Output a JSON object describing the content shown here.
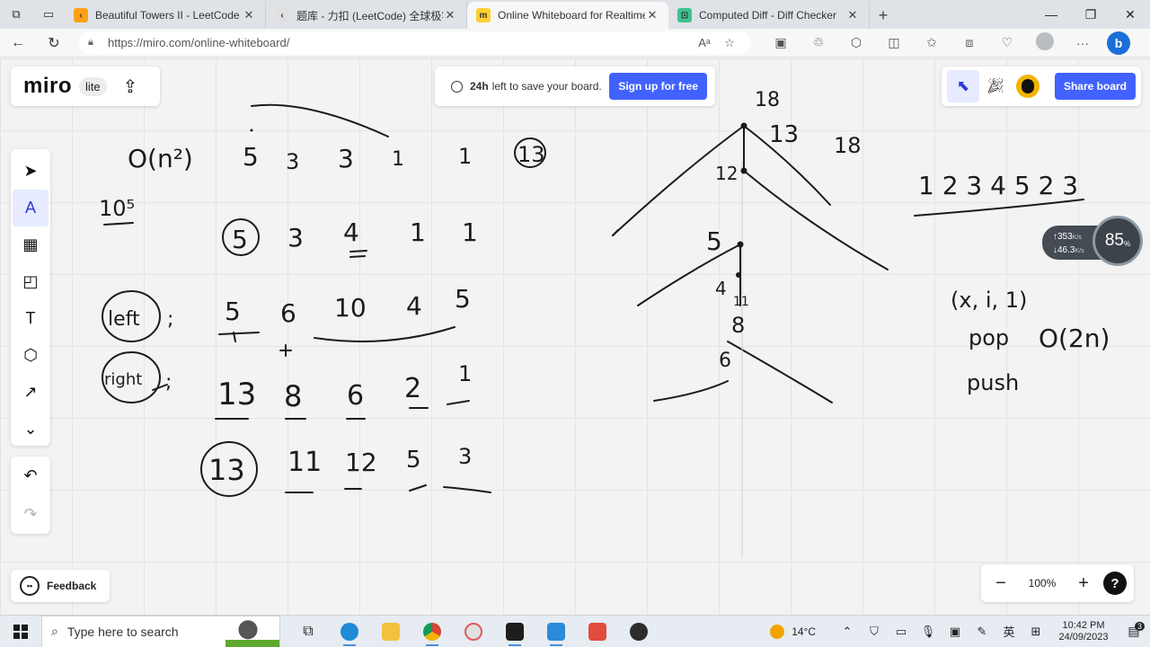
{
  "browser": {
    "tabs": [
      {
        "title": "Beautiful Towers II - LeetCode",
        "fav_color": "#ffa116",
        "fav_glyph": "‹",
        "active": false
      },
      {
        "title": "题库 - 力扣 (LeetCode) 全球极客",
        "fav_color": "#e0e0e0",
        "fav_glyph": "‹",
        "active": false
      },
      {
        "title": "Online Whiteboard for Realtime",
        "fav_color": "#ffd02f",
        "fav_glyph": "m",
        "active": true
      },
      {
        "title": "Computed Diff - Diff Checker",
        "fav_color": "#3ec28f",
        "fav_glyph": "⊡",
        "active": false
      }
    ],
    "url": "https://miro.com/online-whiteboard/"
  },
  "miro": {
    "logo": "miro",
    "badge": "lite",
    "save_banner": {
      "bold": "24h",
      "text": "left to save your board."
    },
    "signup_label": "Sign up for free",
    "share_label": "Share board",
    "feedback_label": "Feedback",
    "zoom_level": "100%",
    "accent": "#4262ff"
  },
  "network": {
    "upload": "353",
    "upload_unit": "K/s",
    "download": "46.3",
    "download_unit": "K/s",
    "percent": "85",
    "percent_unit": "%"
  },
  "taskbar": {
    "search_placeholder": "Type here to search",
    "weather": "14°C",
    "ime": "英",
    "time": "10:42 PM",
    "date": "24/09/2023",
    "notifications": "3"
  },
  "board_text": {
    "complexity": "O(n²)",
    "ten_pow": "10⁵",
    "row1": [
      "5",
      "3",
      "3",
      "1",
      "1"
    ],
    "row1_circled": "13",
    "row2": [
      "5",
      "3",
      "4",
      "1",
      "1"
    ],
    "left_label": "left",
    "left_vals": [
      "5",
      "6",
      "10",
      "4",
      "5"
    ],
    "right_label": "right",
    "right_vals": [
      "13",
      "8",
      "6",
      "2",
      "1"
    ],
    "sum_circled": "13",
    "sum_vals": [
      "11",
      "12",
      "5",
      "3"
    ],
    "tree_top": "18",
    "tree_13": "13",
    "tree_18": "18",
    "tree_12": "12",
    "tree_5": "5",
    "tree_4": "4",
    "tree_11": "11",
    "tree_8": "8",
    "tree_6": "6",
    "seq": "1 2 3 4 5 2 3",
    "tuple": "(x, i, 1)",
    "pop": "pop",
    "o2n": "O(2n)",
    "push": "push"
  }
}
